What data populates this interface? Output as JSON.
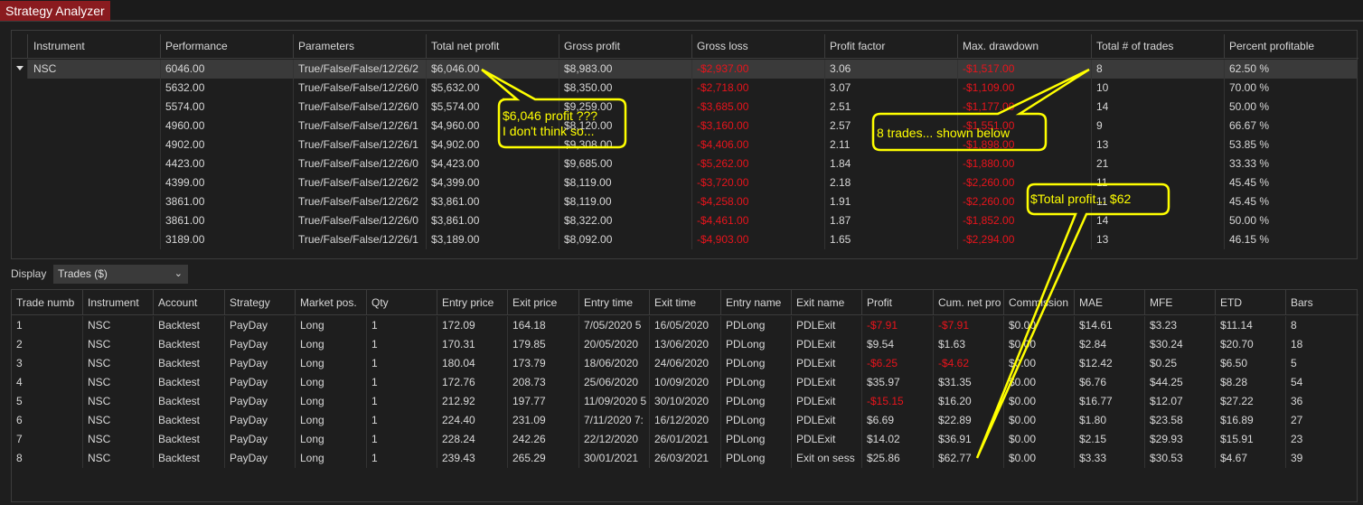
{
  "window": {
    "title": "Strategy Analyzer"
  },
  "results": {
    "columns": [
      "Instrument",
      "Performance",
      "Parameters",
      "Total net profit",
      "Gross profit",
      "Gross loss",
      "Profit factor",
      "Max. drawdown",
      "Total # of trades",
      "Percent profitable"
    ],
    "instrument": "NSC",
    "rows": [
      [
        "6046.00",
        "True/False/False/12/26/2",
        "$6,046.00",
        "$8,983.00",
        "-$2,937.00",
        "3.06",
        "-$1,517.00",
        "8",
        "62.50 %"
      ],
      [
        "5632.00",
        "True/False/False/12/26/0",
        "$5,632.00",
        "$8,350.00",
        "-$2,718.00",
        "3.07",
        "-$1,109.00",
        "10",
        "70.00 %"
      ],
      [
        "5574.00",
        "True/False/False/12/26/0",
        "$5,574.00",
        "$9,259.00",
        "-$3,685.00",
        "2.51",
        "-$1,177.00",
        "14",
        "50.00 %"
      ],
      [
        "4960.00",
        "True/False/False/12/26/1",
        "$4,960.00",
        "$8,120.00",
        "-$3,160.00",
        "2.57",
        "-$1,551.00",
        "9",
        "66.67 %"
      ],
      [
        "4902.00",
        "True/False/False/12/26/1",
        "$4,902.00",
        "$9,308.00",
        "-$4,406.00",
        "2.11",
        "-$1,898.00",
        "13",
        "53.85 %"
      ],
      [
        "4423.00",
        "True/False/False/12/26/0",
        "$4,423.00",
        "$9,685.00",
        "-$5,262.00",
        "1.84",
        "-$1,880.00",
        "21",
        "33.33 %"
      ],
      [
        "4399.00",
        "True/False/False/12/26/2",
        "$4,399.00",
        "$8,119.00",
        "-$3,720.00",
        "2.18",
        "-$2,260.00",
        "11",
        "45.45 %"
      ],
      [
        "3861.00",
        "True/False/False/12/26/2",
        "$3,861.00",
        "$8,119.00",
        "-$4,258.00",
        "1.91",
        "-$2,260.00",
        "11",
        "45.45 %"
      ],
      [
        "3861.00",
        "True/False/False/12/26/0",
        "$3,861.00",
        "$8,322.00",
        "-$4,461.00",
        "1.87",
        "-$1,852.00",
        "14",
        "50.00 %"
      ],
      [
        "3189.00",
        "True/False/False/12/26/1",
        "$3,189.00",
        "$8,092.00",
        "-$4,903.00",
        "1.65",
        "-$2,294.00",
        "13",
        "46.15 %"
      ]
    ]
  },
  "display": {
    "label": "Display",
    "selected": "Trades ($)"
  },
  "trades": {
    "columns": [
      "Trade numb",
      "Instrument",
      "Account",
      "Strategy",
      "Market pos.",
      "Qty",
      "Entry price",
      "Exit price",
      "Entry time",
      "Exit time",
      "Entry name",
      "Exit name",
      "Profit",
      "Cum. net pro",
      "Commission",
      "MAE",
      "MFE",
      "ETD",
      "Bars"
    ],
    "rows": [
      [
        "1",
        "NSC",
        "Backtest",
        "PayDay",
        "Long",
        "1",
        "172.09",
        "164.18",
        "7/05/2020 5",
        "16/05/2020",
        "PDLong",
        "PDLExit",
        "-$7.91",
        "-$7.91",
        "$0.00",
        "$14.61",
        "$3.23",
        "$11.14",
        "8"
      ],
      [
        "2",
        "NSC",
        "Backtest",
        "PayDay",
        "Long",
        "1",
        "170.31",
        "179.85",
        "20/05/2020",
        "13/06/2020",
        "PDLong",
        "PDLExit",
        "$9.54",
        "$1.63",
        "$0.00",
        "$2.84",
        "$30.24",
        "$20.70",
        "18"
      ],
      [
        "3",
        "NSC",
        "Backtest",
        "PayDay",
        "Long",
        "1",
        "180.04",
        "173.79",
        "18/06/2020",
        "24/06/2020",
        "PDLong",
        "PDLExit",
        "-$6.25",
        "-$4.62",
        "$0.00",
        "$12.42",
        "$0.25",
        "$6.50",
        "5"
      ],
      [
        "4",
        "NSC",
        "Backtest",
        "PayDay",
        "Long",
        "1",
        "172.76",
        "208.73",
        "25/06/2020",
        "10/09/2020",
        "PDLong",
        "PDLExit",
        "$35.97",
        "$31.35",
        "$0.00",
        "$6.76",
        "$44.25",
        "$8.28",
        "54"
      ],
      [
        "5",
        "NSC",
        "Backtest",
        "PayDay",
        "Long",
        "1",
        "212.92",
        "197.77",
        "11/09/2020 5",
        "30/10/2020",
        "PDLong",
        "PDLExit",
        "-$15.15",
        "$16.20",
        "$0.00",
        "$16.77",
        "$12.07",
        "$27.22",
        "36"
      ],
      [
        "6",
        "NSC",
        "Backtest",
        "PayDay",
        "Long",
        "1",
        "224.40",
        "231.09",
        "7/11/2020 7:",
        "16/12/2020",
        "PDLong",
        "PDLExit",
        "$6.69",
        "$22.89",
        "$0.00",
        "$1.80",
        "$23.58",
        "$16.89",
        "27"
      ],
      [
        "7",
        "NSC",
        "Backtest",
        "PayDay",
        "Long",
        "1",
        "228.24",
        "242.26",
        "22/12/2020",
        "26/01/2021",
        "PDLong",
        "PDLExit",
        "$14.02",
        "$36.91",
        "$0.00",
        "$2.15",
        "$29.93",
        "$15.91",
        "23"
      ],
      [
        "8",
        "NSC",
        "Backtest",
        "PayDay",
        "Long",
        "1",
        "239.43",
        "265.29",
        "30/01/2021",
        "26/03/2021",
        "PDLong",
        "Exit on sess",
        "$25.86",
        "$62.77",
        "$0.00",
        "$3.33",
        "$30.53",
        "$4.67",
        "39"
      ]
    ]
  },
  "annotations": {
    "profit_note_line1": "$6,046 profit ???",
    "profit_note_line2": "I don't think so...",
    "trades_note": "8 trades... shown below",
    "total_note": "$Total profit... $62"
  },
  "colors": {
    "accent_tab": "#8a1b1f",
    "negative": "#e8141c",
    "annotation": "#ffff00",
    "background": "#1e1e1e",
    "selected_row": "#3a3a3a"
  }
}
